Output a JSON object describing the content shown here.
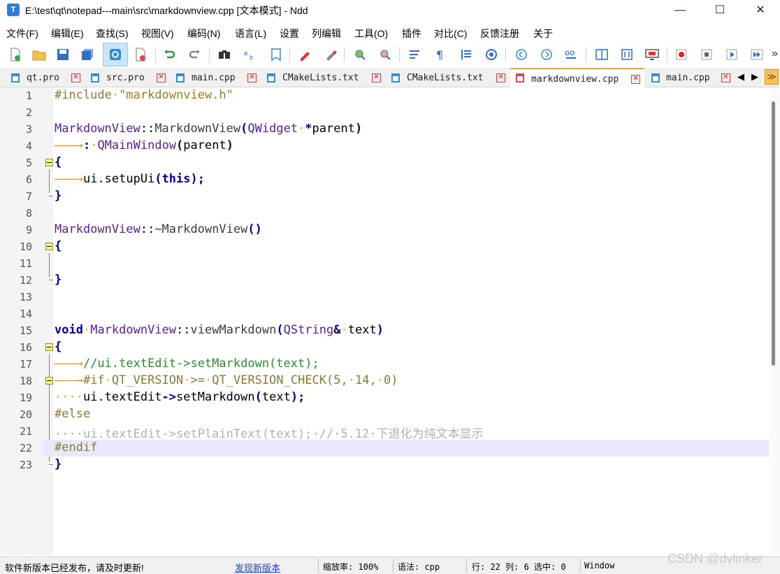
{
  "window": {
    "title": "E:\\test\\qt\\notepad---main\\src\\markdownview.cpp [文本模式] - Ndd",
    "app_icon_letter": "T",
    "minimize_glyph": "—",
    "maximize_glyph": "☐",
    "close_glyph": "✕"
  },
  "menu": [
    "文件(F)",
    "编辑(E)",
    "查找(S)",
    "视图(V)",
    "编码(N)",
    "语言(L)",
    "设置",
    "列编辑",
    "工具(O)",
    "插件",
    "对比(C)",
    "反馈注册",
    "关于"
  ],
  "toolbar": {
    "icons": [
      "new-file-icon",
      "open-file-icon",
      "save-icon",
      "save-all-icon",
      "recent-icon",
      "close-file-icon",
      "undo-icon",
      "redo-icon",
      "find-icon",
      "replace-icon",
      "bookmark-icon",
      "pencil-icon",
      "eraser-icon",
      "zoom-in-icon",
      "zoom-out-icon",
      "wrap-icon",
      "pilcrow-icon",
      "indent-guide-icon",
      "target-icon",
      "nav-back-icon",
      "nav-forward-icon",
      "goto-icon",
      "split-icon",
      "compare-icon",
      "monitor-icon",
      "record-icon",
      "stop-icon",
      "play-icon",
      "fast-forward-icon"
    ],
    "overflow_glyph": "»"
  },
  "tabs": [
    {
      "label": "qt.pro",
      "active": false
    },
    {
      "label": "src.pro",
      "active": false
    },
    {
      "label": "main.cpp",
      "active": false
    },
    {
      "label": "CMakeLists.txt",
      "active": false
    },
    {
      "label": "CMakeLists.txt",
      "active": false
    },
    {
      "label": "markdownview.cpp",
      "active": true
    },
    {
      "label": "main.cpp",
      "active": false
    }
  ],
  "tab_close_glyph": "✕",
  "tab_nav": {
    "prev": "◀",
    "next": "▶",
    "more": "≫"
  },
  "editor": {
    "current_line": 22,
    "lines": [
      {
        "n": "1"
      },
      {
        "n": "2"
      },
      {
        "n": "3"
      },
      {
        "n": "4"
      },
      {
        "n": "5"
      },
      {
        "n": "6"
      },
      {
        "n": "7"
      },
      {
        "n": "8"
      },
      {
        "n": "9"
      },
      {
        "n": "10"
      },
      {
        "n": "11"
      },
      {
        "n": "12"
      },
      {
        "n": "13"
      },
      {
        "n": "14"
      },
      {
        "n": "15"
      },
      {
        "n": "16"
      },
      {
        "n": "17"
      },
      {
        "n": "18"
      },
      {
        "n": "19"
      },
      {
        "n": "20"
      },
      {
        "n": "21"
      },
      {
        "n": "22"
      },
      {
        "n": "23"
      }
    ],
    "code": {
      "l1_pp": "#include",
      "l1_str": "\"markdownview.h\"",
      "l3_cls": "MarkdownView",
      "l3_sep": "::",
      "l3_fn": "MarkdownView",
      "l3_open": "(",
      "l3_type": "QWidget",
      "l3_star": "*",
      "l3_param": "parent",
      "l3_close": ")",
      "l4_colon": ":",
      "l4_cls": "QMainWindow",
      "l4_open": "(",
      "l4_arg": "parent",
      "l4_close": ")",
      "brace_open": "{",
      "brace_close": "}",
      "l6_obj": "ui.setupUi",
      "l6_open": "(",
      "l6_kw": "this",
      "l6_close": ")",
      "l6_semi": ";",
      "l9_cls": "MarkdownView",
      "l9_sep": "::",
      "l9_fn": "~MarkdownView",
      "l9_parens": "()",
      "l15_kw": "void",
      "l15_cls": "MarkdownView",
      "l15_sep": "::",
      "l15_fn": "viewMarkdown",
      "l15_open": "(",
      "l15_type": "QString",
      "l15_amp": "&",
      "l15_param": "text",
      "l15_close": ")",
      "l17_comment": "//ui.textEdit->setMarkdown(text);",
      "l18_pp": "#if",
      "l18_a": "QT_VERSION",
      "l18_op": ">=",
      "l18_b": "QT_VERSION_CHECK(5,",
      "l18_c": "14,",
      "l18_d": "0)",
      "l19_a": "ui.textEdit",
      "l19_arrow": "->",
      "l19_b": "setMarkdown",
      "l19_open": "(",
      "l19_arg": "text",
      "l19_close": ")",
      "l19_semi": ";",
      "l20_pp": "#else",
      "l21_a": "ui.textEdit->setPlainText(text);",
      "l21_b": "//",
      "l21_c": "5.12",
      "l21_d": "下退化为纯文本显示",
      "l22_pp": "#endif"
    }
  },
  "status": {
    "message": "软件新版本已经发布，请及时更新!",
    "link": "发现新版本",
    "zoom": "缩放率: 100%",
    "syntax": "语法: cpp",
    "position": "行: 22  列: 6  选中: 0",
    "eol": "Windows"
  },
  "watermark": "CSDN @dvlinker"
}
